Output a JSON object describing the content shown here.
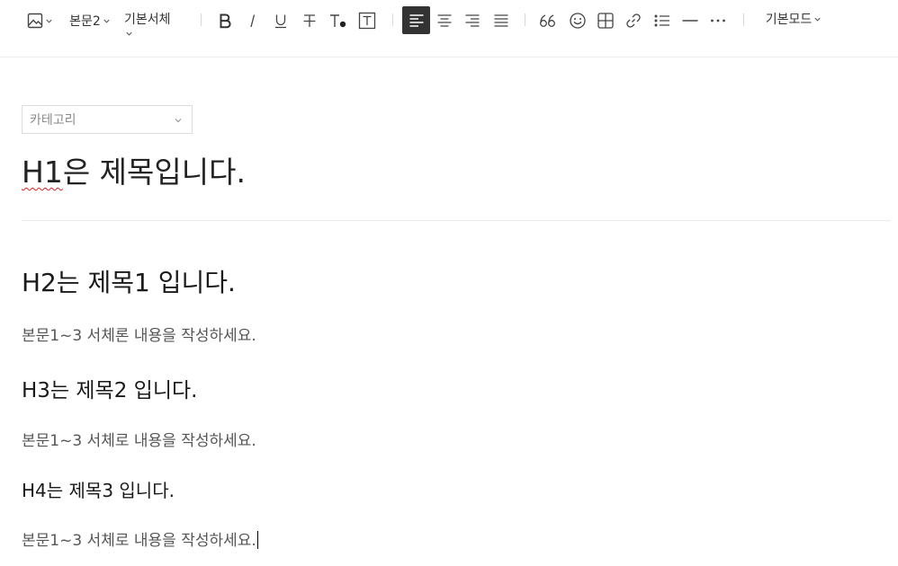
{
  "toolbar": {
    "paragraph_style": "본문2",
    "font_family": "기본서체",
    "mode": "기본모드",
    "icons": [
      "image-icon",
      "bold-icon",
      "italic-icon",
      "underline-icon",
      "strikethrough-icon",
      "text-color-icon",
      "text-background-icon",
      "align-left-icon",
      "align-center-icon",
      "align-right-icon",
      "align-justify-icon",
      "quote-icon",
      "emoji-icon",
      "table-icon",
      "link-icon",
      "list-icon",
      "horizontal-rule-icon",
      "more-icon"
    ],
    "active_alignment": "left",
    "active_color": "#333333"
  },
  "category": {
    "placeholder": "카테고리"
  },
  "document": {
    "title_spell": "H1",
    "title_rest": "은 제목입니다.",
    "h2": "H2는 제목1 입니다.",
    "p1": "본문1~3 서체론 내용을 작성하세요.",
    "h3": "H3는 제목2 입니다.",
    "p2": "본문1~3 서체로 내용을 작성하세요.",
    "h4": "H4는 제목3 입니다.",
    "p3": "본문1~3 서체로 내용을 작성하세요."
  }
}
